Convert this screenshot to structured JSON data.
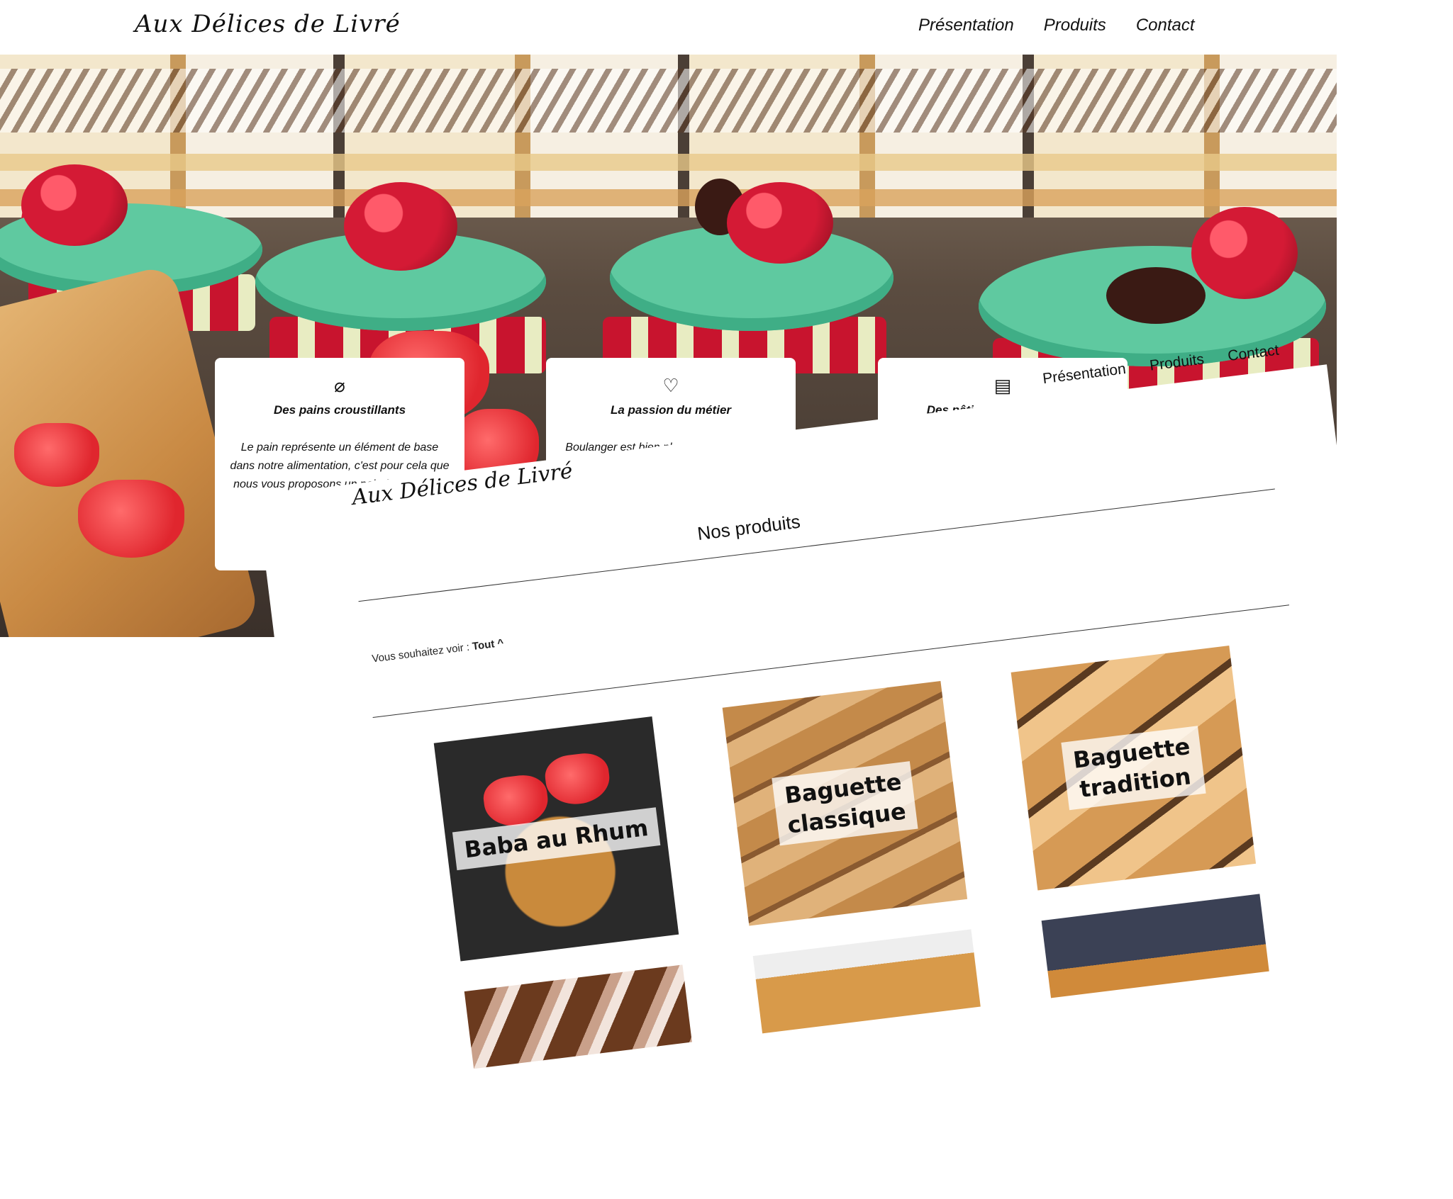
{
  "header": {
    "logo": "Aux Délices de Livré",
    "nav": [
      "Présentation",
      "Produits",
      "Contact"
    ]
  },
  "features": [
    {
      "icon": "bread-icon",
      "title": "Des pains croustillants",
      "text": "Le pain représente un élément de base dans notre alimentation, c'est pour cela que nous vous proposons un pain frais et plein de saveur."
    },
    {
      "icon": "hand-heart-icon",
      "title": "La passion du métier",
      "text": "Boulanger est bien plus qu'un métier mais une passion qui nous a... quotidi..."
    },
    {
      "icon": "cake-icon",
      "title": "Des pâtisseries originale..."
    }
  ],
  "products_section": {
    "nav": [
      "Présentation",
      "Produits",
      "Contact"
    ],
    "logo": "Aux Délices de Livré",
    "title": "Nos produits",
    "filter_label": "Vous souhaitez voir :",
    "filter_value": "Tout",
    "filter_caret": "^",
    "items": [
      {
        "name": "Baba au Rhum"
      },
      {
        "name": "Baguette\nclassique"
      },
      {
        "name": "Baguette\ntradition"
      }
    ]
  }
}
